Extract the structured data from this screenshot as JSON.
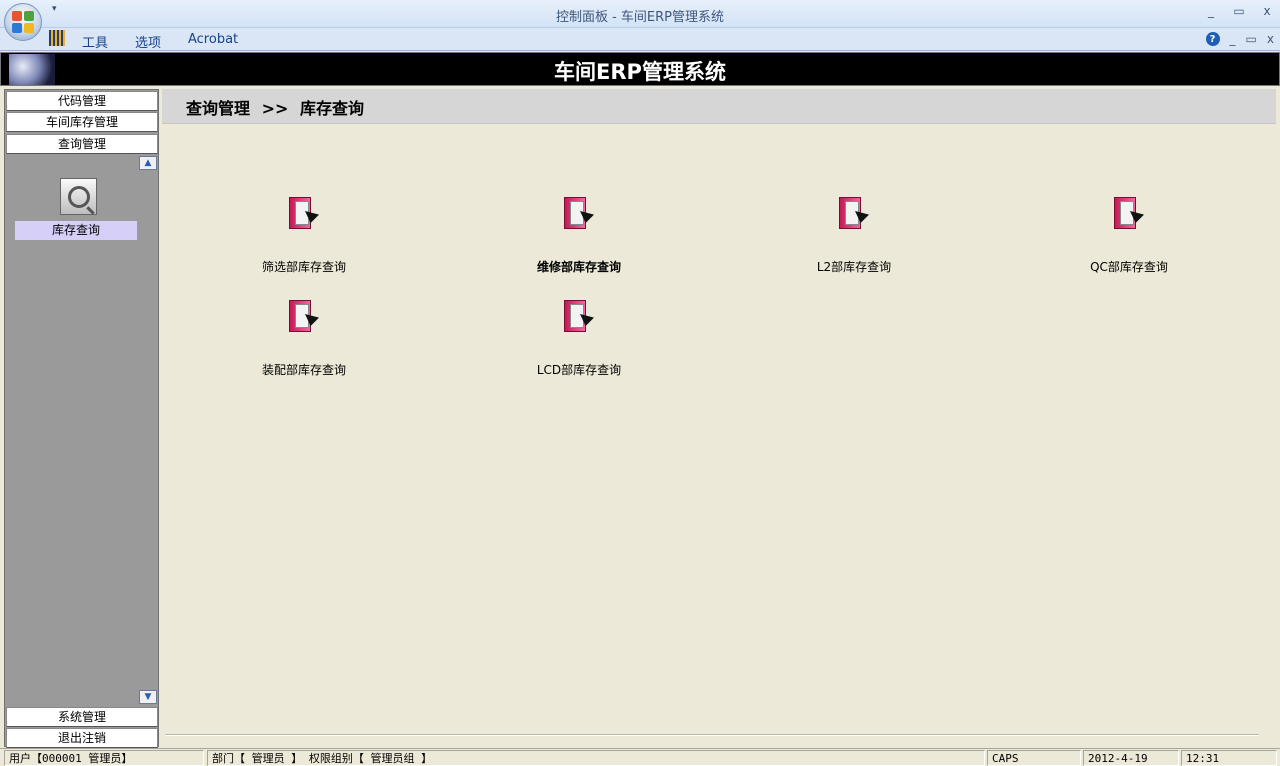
{
  "window": {
    "title": "控制面板 - 车间ERP管理系统",
    "controls": [
      "_",
      "▭",
      "x"
    ]
  },
  "menu": {
    "items": [
      "工具",
      "选项",
      "Acrobat"
    ],
    "right_controls": [
      "?",
      "_",
      "▭",
      "x"
    ]
  },
  "header": {
    "title": "车间ERP管理系统"
  },
  "sidebar": {
    "groups_top": [
      "代码管理",
      "车间库存管理",
      "查询管理"
    ],
    "active_item": "库存查询",
    "groups_bottom": [
      "系统管理",
      "退出注销"
    ]
  },
  "breadcrumb": {
    "parent": "查询管理",
    "separator": ">>",
    "current": "库存查询"
  },
  "tiles": [
    {
      "label": "筛选部库存查询",
      "icon": "folder-report-icon",
      "bold": false
    },
    {
      "label": "维修部库存查询",
      "icon": "folder-report-icon",
      "bold": true
    },
    {
      "label": "L2部库存查询",
      "icon": "folder-report-icon",
      "bold": false
    },
    {
      "label": "QC部库存查询",
      "icon": "folder-report-icon",
      "bold": false
    },
    {
      "label": "装配部库存查询",
      "icon": "folder-report-icon",
      "bold": false
    },
    {
      "label": "LCD部库存查询",
      "icon": "folder-report-icon",
      "bold": false
    }
  ],
  "status": {
    "user": "用户【000001 管理员】",
    "dept": "部门【 管理员 】 权限组别【 管理员组 】",
    "caps": "CAPS",
    "date": "2012-4-19",
    "time": "12:31"
  },
  "colors": {
    "background": "#ECE9D8",
    "sidebar": "#9a9a9a",
    "header": "#000000",
    "selected": "#d6d0f8"
  }
}
